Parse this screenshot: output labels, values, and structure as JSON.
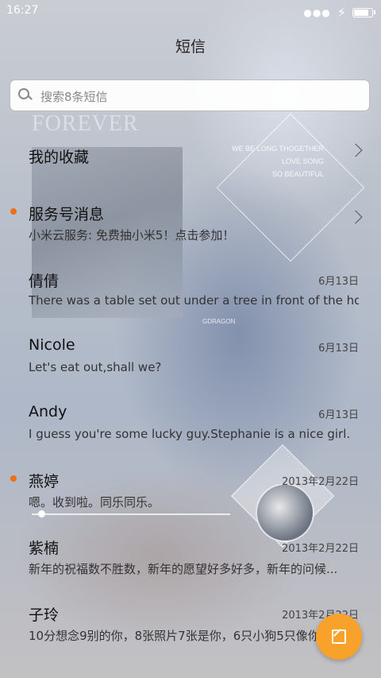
{
  "status_bar": {
    "time": "16:27",
    "battery_level": 0.92
  },
  "header": {
    "title": "短信"
  },
  "search": {
    "placeholder": "搜索8条短信"
  },
  "wallpaper": {
    "watermark": "FOREVER",
    "lyrics": [
      "WE BE LONG THOGETHER",
      "LOVE SONG",
      "SO BEAUTIFUL"
    ],
    "tag": "GDRAGON"
  },
  "messages": [
    {
      "name": "我的收藏",
      "preview": "",
      "date": "",
      "unread": false,
      "chevron": true
    },
    {
      "name": "服务号消息",
      "preview": "小米云服务: 免费抽小米5！点击参加！",
      "date": "",
      "unread": true,
      "chevron": true
    },
    {
      "name": "倩倩",
      "preview": "There was a table set out under a tree in front of the ho...",
      "date": "6月13日",
      "unread": false,
      "chevron": false
    },
    {
      "name": "Nicole",
      "preview": "Let's eat out,shall we?",
      "date": "6月13日",
      "unread": false,
      "chevron": false
    },
    {
      "name": "Andy",
      "preview": "I guess you're some lucky guy.Stephanie is a nice girl.",
      "date": "6月13日",
      "unread": false,
      "chevron": false
    },
    {
      "name": "燕婷",
      "preview": "嗯。收到啦。同乐同乐。",
      "date": "2013年2月22日",
      "unread": true,
      "chevron": false
    },
    {
      "name": "紫楠",
      "preview": "新年的祝福数不胜数，新年的愿望好多好多，新年的问候...",
      "date": "2013年2月22日",
      "unread": false,
      "chevron": false
    },
    {
      "name": "子玲",
      "preview": "10分想念9别的你，8张照片7张是你，6只小狗5只像你...",
      "date": "2013年2月22日",
      "unread": false,
      "chevron": false
    }
  ],
  "compose_button": {
    "icon": "edit-icon",
    "color": "#f8a22b"
  },
  "accent": {
    "unread_dot": "#f26d1a"
  }
}
